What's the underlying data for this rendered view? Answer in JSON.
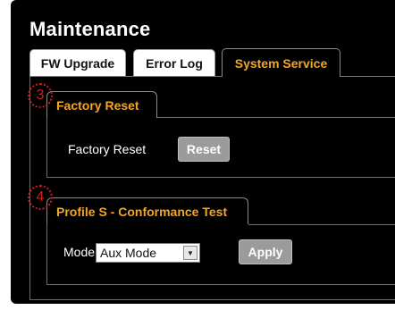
{
  "page": {
    "title": "Maintenance"
  },
  "tabs": [
    {
      "label": "FW Upgrade"
    },
    {
      "label": "Error Log"
    },
    {
      "label": "System Service"
    }
  ],
  "factory_reset": {
    "marker": "3",
    "title": "Factory Reset",
    "label": "Factory Reset",
    "button": "Reset"
  },
  "conformance": {
    "marker": "4",
    "title": "Profile S - Conformance Test",
    "mode_label": "Mode",
    "mode_value": "Aux Mode",
    "button": "Apply"
  },
  "colors": {
    "accent": "#f5a623",
    "background": "#000000",
    "button": "#9b9b9b",
    "marker": "#cc1f1f"
  }
}
